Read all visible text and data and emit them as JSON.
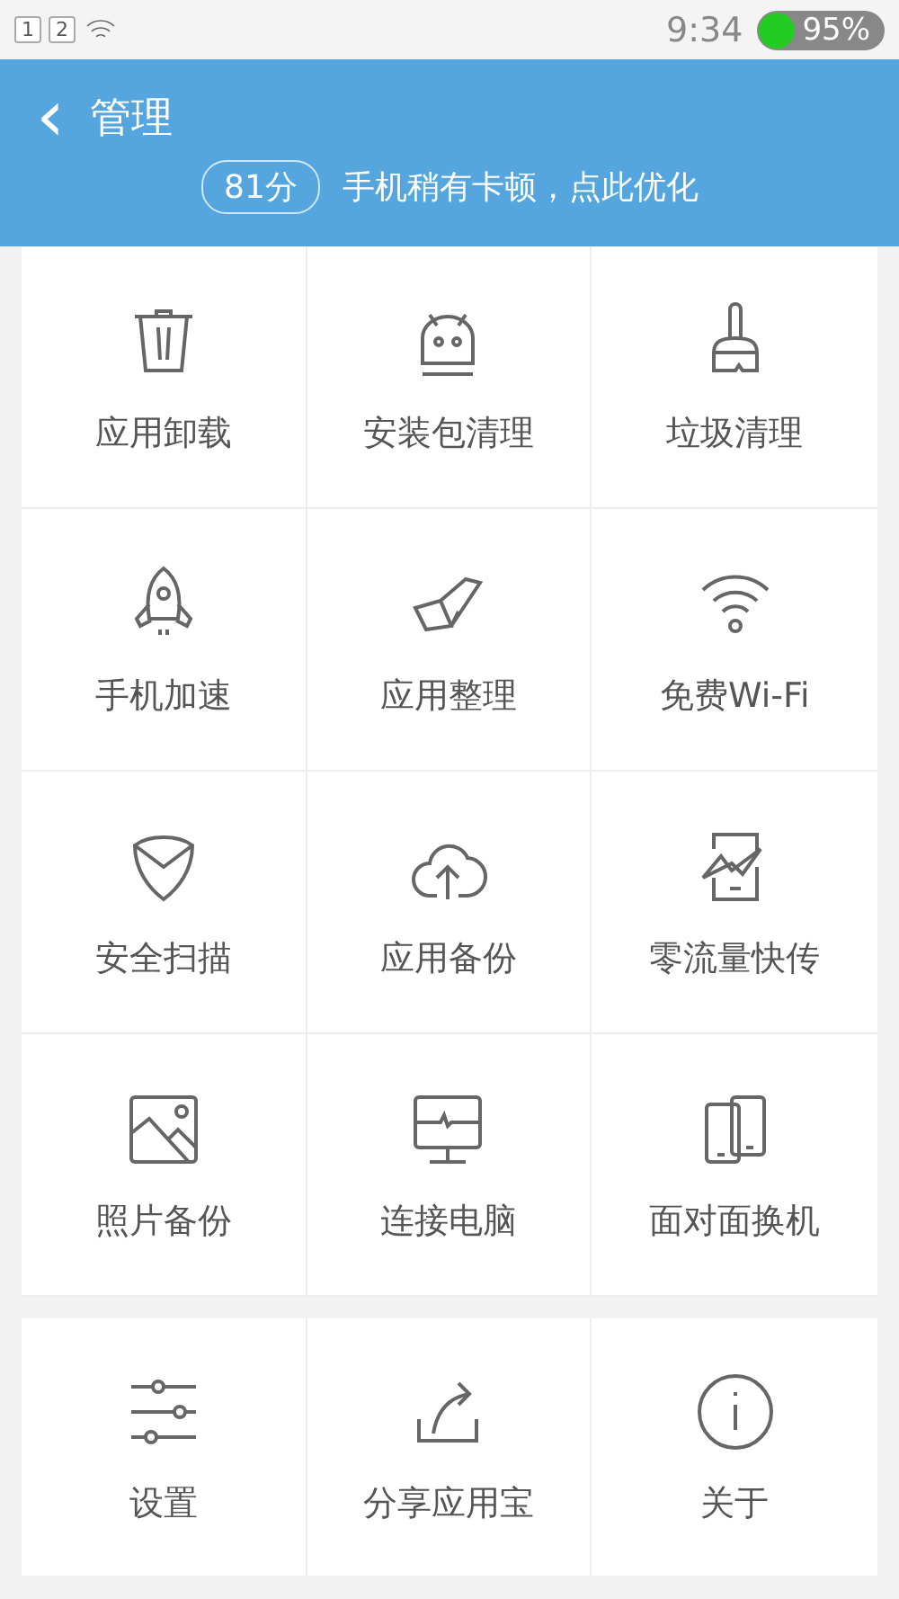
{
  "status_bar": {
    "sims": [
      "1",
      "2"
    ],
    "time": "9:34",
    "battery": "95%"
  },
  "header": {
    "back": "‹",
    "title": "管理",
    "score": "81分",
    "hint": "手机稍有卡顿，点此优化"
  },
  "tools": [
    {
      "label": "应用卸载",
      "kind": "trash"
    },
    {
      "label": "安装包清理",
      "kind": "robot"
    },
    {
      "label": "垃圾清理",
      "kind": "brush"
    },
    {
      "label": "手机加速",
      "kind": "rocket"
    },
    {
      "label": "应用整理",
      "kind": "fold"
    },
    {
      "label": "免费Wi-Fi",
      "kind": "wifi"
    },
    {
      "label": "安全扫描",
      "kind": "shield"
    },
    {
      "label": "应用备份",
      "kind": "cloud"
    },
    {
      "label": "零流量快传",
      "kind": "tablet"
    },
    {
      "label": "照片备份",
      "kind": "image"
    },
    {
      "label": "连接电脑",
      "kind": "monitor"
    },
    {
      "label": "面对面换机",
      "kind": "phones"
    }
  ],
  "more": [
    {
      "label": "设置",
      "kind": "sliders"
    },
    {
      "label": "分享应用宝",
      "kind": "share"
    },
    {
      "label": "关于",
      "kind": "info"
    }
  ]
}
